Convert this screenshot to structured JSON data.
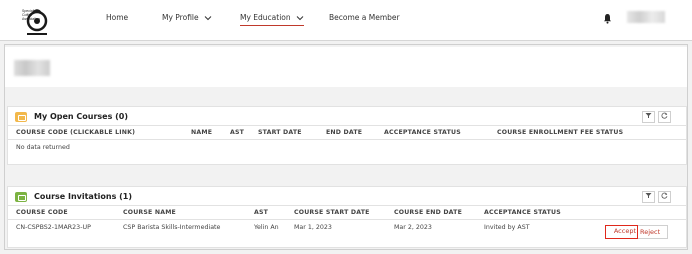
{
  "logo": {
    "text": "Specialty\nCoffee\nAssociation"
  },
  "nav": {
    "home": "Home",
    "profile": "My Profile",
    "education": "My Education",
    "member": "Become a Member"
  },
  "open_courses": {
    "title": "My Open Courses (0)",
    "columns": [
      "COURSE CODE (CLICKABLE LINK)",
      "NAME",
      "AST",
      "START DATE",
      "END DATE",
      "ACCEPTANCE STATUS",
      "COURSE ENROLLMENT FEE STATUS"
    ],
    "empty": "No data returned"
  },
  "invitations": {
    "title": "Course Invitations (1)",
    "columns": [
      "COURSE CODE",
      "COURSE NAME",
      "AST",
      "COURSE START DATE",
      "COURSE END DATE",
      "ACCEPTANCE STATUS"
    ],
    "rows": [
      {
        "code": "CN-CSPBS2-1MAR23-UP",
        "name": "CSP Barista Skills-Intermediate",
        "ast": "Yelin An",
        "start": "Mar 1, 2023",
        "end": "Mar 2, 2023",
        "status": "Invited by AST"
      }
    ],
    "accept": "Accept",
    "reject": "Reject"
  },
  "icons": {
    "filter": "filter-icon",
    "refresh": "refresh-icon",
    "bell": "bell-icon",
    "chevron": "chevron-down-icon"
  },
  "colors": {
    "accent": "#c0392b",
    "open_icon": "#f2b84b",
    "invite_icon": "#7cb342"
  }
}
